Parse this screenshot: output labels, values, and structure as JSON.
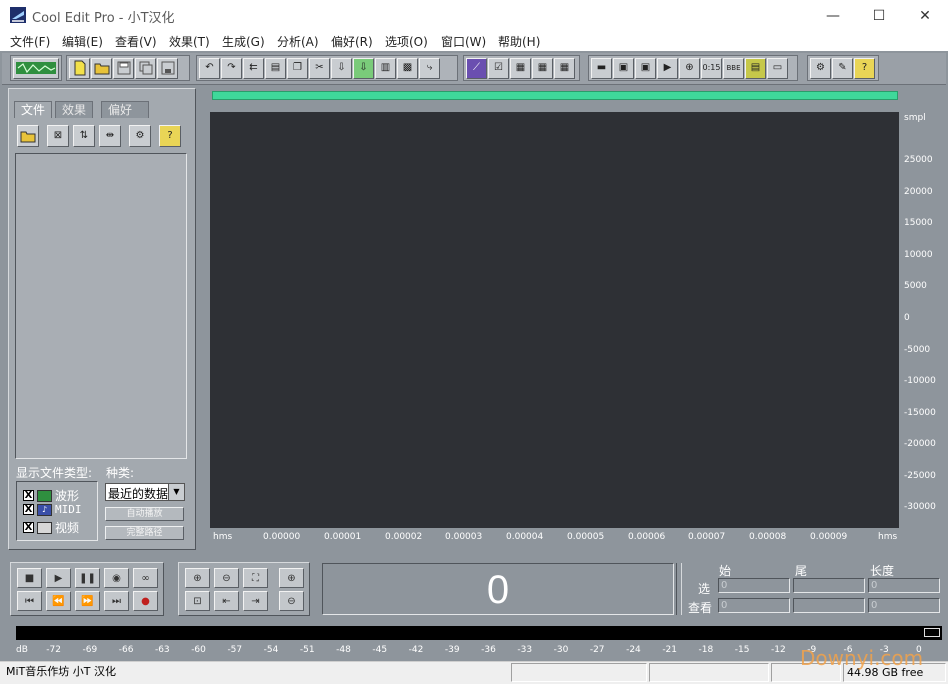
{
  "window": {
    "title": "Cool Edit Pro  - 小T汉化",
    "minimize_glyph": "—",
    "maximize_glyph": "☐",
    "close_glyph": "✕"
  },
  "menu": [
    "文件(F)",
    "编辑(E)",
    "查看(V)",
    "效果(T)",
    "生成(G)",
    "分析(A)",
    "偏好(R)",
    "选项(O)",
    "窗口(W)",
    "帮助(H)"
  ],
  "left_panel": {
    "tabs": [
      "文件",
      "效果",
      "偏好"
    ],
    "show_types_label": "显示文件类型:",
    "category_label": "种类:",
    "file_types": [
      {
        "label": "波形",
        "checked": "X"
      },
      {
        "label": "MIDI",
        "checked": "X"
      },
      {
        "label": "视频",
        "checked": "X"
      }
    ],
    "category_value": "最近的数据",
    "auto_play_label": "自动播放",
    "full_path_label": "完整路径",
    "help_glyph": "?"
  },
  "waveform": {
    "y_unit": "smpl",
    "y_ticks": [
      "25000",
      "20000",
      "15000",
      "10000",
      "5000",
      "0",
      "-5000",
      "-10000",
      "-15000",
      "-20000",
      "-25000",
      "-30000"
    ],
    "x_unit_left": "hms",
    "x_unit_right": "hms",
    "x_ticks": [
      "0.00000",
      "0.00001",
      "0.00002",
      "0.00003",
      "0.00004",
      "0.00005",
      "0.00006",
      "0.00007",
      "0.00008",
      "0.00009"
    ]
  },
  "transport": {
    "time": "0"
  },
  "selection": {
    "begin_label": "始",
    "end_label": "尾",
    "length_label": "长度",
    "select_label": "选",
    "view_label": "查看",
    "values": [
      "0",
      "",
      "0",
      "0",
      "",
      "0"
    ]
  },
  "meter": {
    "labels": [
      "dB",
      "-72",
      "-69",
      "-66",
      "-63",
      "-60",
      "-57",
      "-54",
      "-51",
      "-48",
      "-45",
      "-42",
      "-39",
      "-36",
      "-33",
      "-30",
      "-27",
      "-24",
      "-21",
      "-18",
      "-15",
      "-12",
      "-9",
      "-6",
      "-3",
      "0"
    ]
  },
  "status": {
    "left": "MiT音乐作坊 小T 汉化",
    "free_space": "44.98 GB free",
    "watermark": "Downyi.com"
  },
  "colors": {
    "overview": "#3fd89a",
    "wave_bg": "#2e3035",
    "workspace": "#8e959c"
  }
}
